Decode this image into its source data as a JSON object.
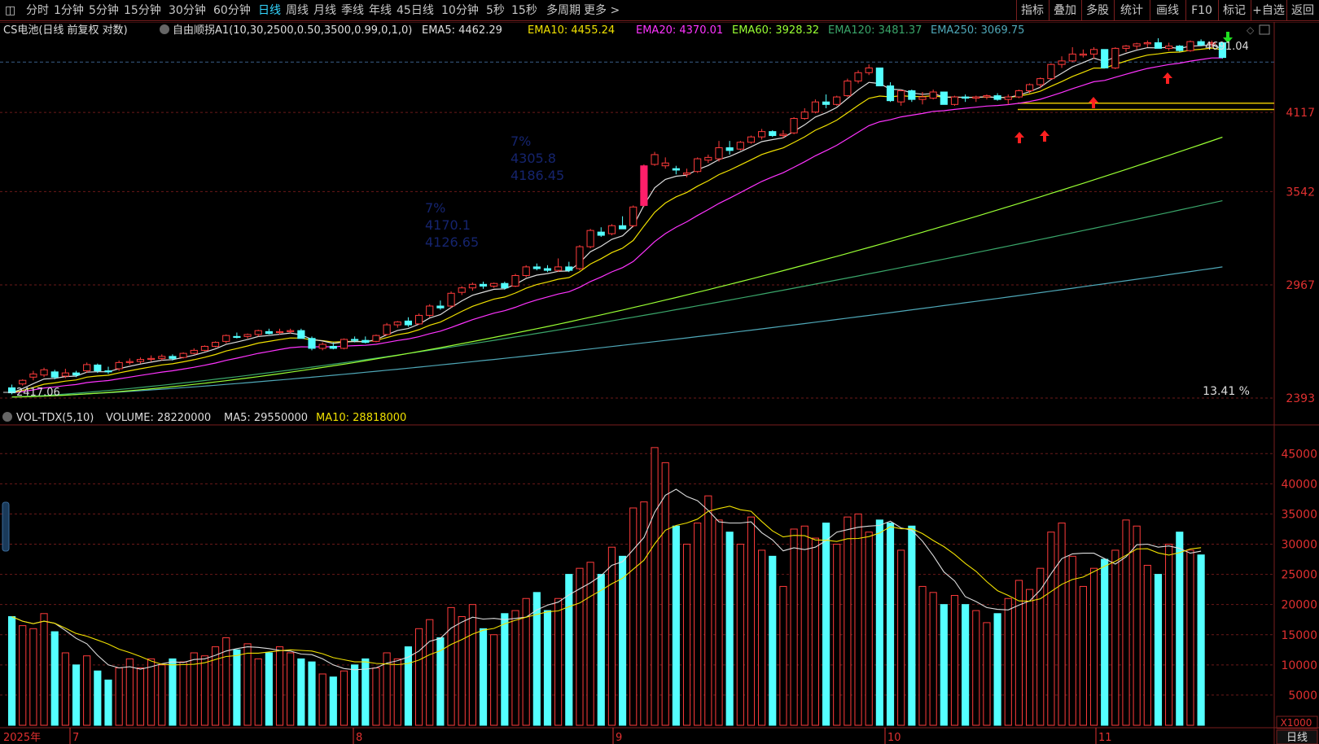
{
  "toolbar": {
    "left_items": [
      "分时",
      "1分钟",
      "5分钟",
      "15分钟",
      "30分钟",
      "60分钟",
      "日线",
      "周线",
      "月线",
      "季线",
      "年线",
      "45日线",
      "10分钟",
      "5秒",
      "15秒",
      "多周期",
      "更多 >"
    ],
    "active_index": 6,
    "right_items": [
      "指标",
      "叠加",
      "多股",
      "统计",
      "画线",
      "F10",
      "标记",
      "+自选",
      "返回"
    ]
  },
  "main_panel": {
    "stock_title": "CS电池(日线 前复权 对数)",
    "indicator_name": "自由顺拐A1(10,30,2500,0.50,3500,0.99,0,1,0)",
    "ema_labels": [
      {
        "text": "EMA5: 4462.29",
        "color": "#dddddd"
      },
      {
        "text": "EMA10: 4455.24",
        "color": "#f0e000"
      },
      {
        "text": "EMA20: 4370.01",
        "color": "#ff33ff"
      },
      {
        "text": "EMA60: 3928.32",
        "color": "#99ff33"
      },
      {
        "text": "EMA120: 3481.37",
        "color": "#3aa66a"
      },
      {
        "text": "EMA250: 3069.75",
        "color": "#4fa8b8"
      }
    ],
    "price_axis": [
      {
        "text": "4117",
        "value": 4117
      },
      {
        "text": "3542",
        "value": 3542
      },
      {
        "text": "2967",
        "value": 2967
      },
      {
        "text": "2393",
        "value": 2393
      }
    ],
    "low_marker": "2417.06",
    "high_marker": "4691.04",
    "percent": "13.41 %",
    "dim_annotations": [
      {
        "lines": [
          "7%",
          "4305.8",
          "4186.45"
        ]
      },
      {
        "lines": [
          "7%",
          "4170.1",
          "4126.65"
        ]
      }
    ]
  },
  "volume_panel": {
    "title": "VOL-TDX(5,10)",
    "volume_label": "VOLUME: 28220000",
    "ma5_label": "MA5: 29550000",
    "ma10_label": "MA10: 28818000",
    "axis": [
      {
        "text": "45000",
        "value": 45000
      },
      {
        "text": "40000",
        "value": 40000
      },
      {
        "text": "35000",
        "value": 35000
      },
      {
        "text": "30000",
        "value": 30000
      },
      {
        "text": "25000",
        "value": 25000
      },
      {
        "text": "20000",
        "value": 20000
      },
      {
        "text": "15000",
        "value": 15000
      },
      {
        "text": "10000",
        "value": 10000
      },
      {
        "text": "5000",
        "value": 5000
      }
    ],
    "unit": "X1000"
  },
  "date_axis": {
    "year_label": "2025年",
    "months": [
      "7",
      "8",
      "9",
      "10",
      "11"
    ],
    "period": "日线"
  },
  "chart_data": {
    "type": "candlestick",
    "title": "CS电池(日线 前复权 对数)",
    "scale": "log",
    "ylim": [
      2393,
      4740
    ],
    "candles": [
      [
        2440,
        2455,
        2410,
        2417
      ],
      [
        2458,
        2480,
        2450,
        2475
      ],
      [
        2490,
        2520,
        2475,
        2505
      ],
      [
        2500,
        2535,
        2490,
        2525
      ],
      [
        2515,
        2525,
        2480,
        2490
      ],
      [
        2495,
        2530,
        2485,
        2510
      ],
      [
        2510,
        2520,
        2490,
        2500
      ],
      [
        2520,
        2560,
        2510,
        2550
      ],
      [
        2548,
        2555,
        2510,
        2520
      ],
      [
        2520,
        2540,
        2505,
        2515
      ],
      [
        2530,
        2570,
        2520,
        2560
      ],
      [
        2560,
        2580,
        2550,
        2565
      ],
      [
        2565,
        2585,
        2555,
        2575
      ],
      [
        2575,
        2595,
        2565,
        2580
      ],
      [
        2580,
        2600,
        2570,
        2590
      ],
      [
        2590,
        2600,
        2570,
        2580
      ],
      [
        2585,
        2610,
        2580,
        2605
      ],
      [
        2605,
        2630,
        2600,
        2620
      ],
      [
        2620,
        2645,
        2615,
        2640
      ],
      [
        2640,
        2665,
        2635,
        2660
      ],
      [
        2665,
        2700,
        2655,
        2695
      ],
      [
        2690,
        2710,
        2680,
        2685
      ],
      [
        2690,
        2705,
        2680,
        2700
      ],
      [
        2700,
        2725,
        2690,
        2720
      ],
      [
        2715,
        2730,
        2700,
        2705
      ],
      [
        2710,
        2730,
        2700,
        2715
      ],
      [
        2715,
        2730,
        2705,
        2720
      ],
      [
        2720,
        2730,
        2690,
        2680
      ],
      [
        2680,
        2690,
        2620,
        2630
      ],
      [
        2630,
        2660,
        2620,
        2650
      ],
      [
        2640,
        2660,
        2625,
        2630
      ],
      [
        2630,
        2680,
        2625,
        2675
      ],
      [
        2675,
        2690,
        2660,
        2670
      ],
      [
        2670,
        2690,
        2655,
        2660
      ],
      [
        2665,
        2700,
        2660,
        2695
      ],
      [
        2700,
        2760,
        2695,
        2750
      ],
      [
        2750,
        2770,
        2735,
        2765
      ],
      [
        2770,
        2790,
        2740,
        2750
      ],
      [
        2755,
        2810,
        2750,
        2800
      ],
      [
        2800,
        2860,
        2790,
        2850
      ],
      [
        2850,
        2880,
        2830,
        2840
      ],
      [
        2850,
        2930,
        2840,
        2920
      ],
      [
        2925,
        2960,
        2910,
        2950
      ],
      [
        2950,
        2980,
        2935,
        2970
      ],
      [
        2970,
        2985,
        2945,
        2960
      ],
      [
        2960,
        2980,
        2950,
        2975
      ],
      [
        2975,
        2985,
        2940,
        2950
      ],
      [
        2960,
        3030,
        2955,
        3020
      ],
      [
        3020,
        3080,
        3010,
        3070
      ],
      [
        3070,
        3090,
        3050,
        3060
      ],
      [
        3060,
        3080,
        3040,
        3050
      ],
      [
        3050,
        3120,
        3040,
        3070
      ],
      [
        3070,
        3100,
        3040,
        3050
      ],
      [
        3060,
        3200,
        3050,
        3190
      ],
      [
        3190,
        3300,
        3180,
        3290
      ],
      [
        3280,
        3310,
        3250,
        3260
      ],
      [
        3270,
        3330,
        3260,
        3320
      ],
      [
        3320,
        3380,
        3310,
        3300
      ],
      [
        3320,
        3450,
        3310,
        3440
      ],
      [
        3450,
        3730,
        3440,
        3720
      ],
      [
        3730,
        3820,
        3720,
        3800
      ],
      [
        3720,
        3780,
        3700,
        3740
      ],
      [
        3700,
        3720,
        3660,
        3690
      ],
      [
        3660,
        3700,
        3640,
        3670
      ],
      [
        3680,
        3780,
        3670,
        3770
      ],
      [
        3760,
        3800,
        3740,
        3780
      ],
      [
        3770,
        3900,
        3750,
        3850
      ],
      [
        3850,
        3900,
        3800,
        3830
      ],
      [
        3840,
        3900,
        3830,
        3890
      ],
      [
        3890,
        3940,
        3880,
        3930
      ],
      [
        3930,
        3990,
        3910,
        3970
      ],
      [
        3970,
        3980,
        3930,
        3940
      ],
      [
        3940,
        3980,
        3920,
        3950
      ],
      [
        3960,
        4080,
        3950,
        4070
      ],
      [
        4070,
        4150,
        4060,
        4120
      ],
      [
        4120,
        4220,
        4110,
        4200
      ],
      [
        4200,
        4260,
        4150,
        4180
      ],
      [
        4180,
        4250,
        4170,
        4240
      ],
      [
        4250,
        4390,
        4240,
        4370
      ],
      [
        4370,
        4460,
        4350,
        4440
      ],
      [
        4440,
        4510,
        4420,
        4480
      ],
      [
        4480,
        4420,
        4340,
        4330
      ],
      [
        4330,
        4360,
        4200,
        4210
      ],
      [
        4200,
        4300,
        4170,
        4290
      ],
      [
        4290,
        4300,
        4200,
        4220
      ],
      [
        4220,
        4280,
        4180,
        4240
      ],
      [
        4230,
        4300,
        4220,
        4280
      ],
      [
        4280,
        4240,
        4180,
        4180
      ],
      [
        4180,
        4250,
        4170,
        4240
      ],
      [
        4240,
        4260,
        4200,
        4230
      ],
      [
        4230,
        4250,
        4200,
        4240
      ],
      [
        4240,
        4260,
        4220,
        4250
      ],
      [
        4250,
        4270,
        4210,
        4220
      ],
      [
        4220,
        4260,
        4180,
        4240
      ],
      [
        4240,
        4300,
        4230,
        4290
      ],
      [
        4290,
        4350,
        4270,
        4340
      ],
      [
        4340,
        4400,
        4310,
        4390
      ],
      [
        4390,
        4520,
        4380,
        4510
      ],
      [
        4510,
        4580,
        4480,
        4540
      ],
      [
        4540,
        4660,
        4530,
        4600
      ],
      [
        4590,
        4640,
        4570,
        4600
      ],
      [
        4600,
        4660,
        4560,
        4640
      ],
      [
        4640,
        4560,
        4480,
        4480
      ],
      [
        4480,
        4660,
        4470,
        4650
      ],
      [
        4650,
        4680,
        4620,
        4670
      ],
      [
        4670,
        4700,
        4640,
        4690
      ],
      [
        4690,
        4720,
        4660,
        4700
      ],
      [
        4700,
        4740,
        4670,
        4650
      ],
      [
        4650,
        4700,
        4630,
        4670
      ],
      [
        4670,
        4680,
        4620,
        4630
      ],
      [
        4630,
        4720,
        4620,
        4710
      ],
      [
        4710,
        4730,
        4670,
        4680
      ],
      [
        4690,
        4720,
        4660,
        4700
      ],
      [
        4700,
        4691,
        4560,
        4570
      ]
    ],
    "volume_series": {
      "name": "VOLUME",
      "unit": "X1000",
      "values": [
        18000,
        16500,
        16000,
        18500,
        15500,
        12000,
        10000,
        11500,
        9000,
        7500,
        9500,
        11000,
        9500,
        11000,
        10000,
        11000,
        10500,
        12000,
        11500,
        13000,
        14500,
        12500,
        13500,
        11000,
        12000,
        13000,
        12000,
        11000,
        10500,
        8500,
        8000,
        9000,
        10000,
        11000,
        9500,
        12000,
        11000,
        13000,
        16000,
        17500,
        14500,
        19500,
        18000,
        20000,
        16000,
        15000,
        18500,
        19000,
        21000,
        22000,
        19000,
        21000,
        25000,
        26000,
        27000,
        25000,
        29500,
        28000,
        36000,
        37000,
        46000,
        43500,
        33000,
        30000,
        33500,
        38000,
        34000,
        32000,
        30000,
        34500,
        29000,
        28000,
        23000,
        32500,
        33000,
        31000,
        33500,
        30000,
        34500,
        35000,
        32000,
        34000,
        33500,
        29000,
        33000,
        23000,
        22000,
        20000,
        21500,
        20000,
        19000,
        17000,
        18500,
        21000,
        24000,
        22500,
        26000,
        32000,
        33500,
        28000,
        23000,
        26000,
        27500,
        29000,
        34000,
        33000,
        26500,
        25000,
        30000,
        32000,
        29000,
        28220
      ]
    },
    "ma_series_labels": [
      {
        "name": "MA5",
        "value": 29550000
      },
      {
        "name": "MA10",
        "value": 28818000
      }
    ]
  }
}
